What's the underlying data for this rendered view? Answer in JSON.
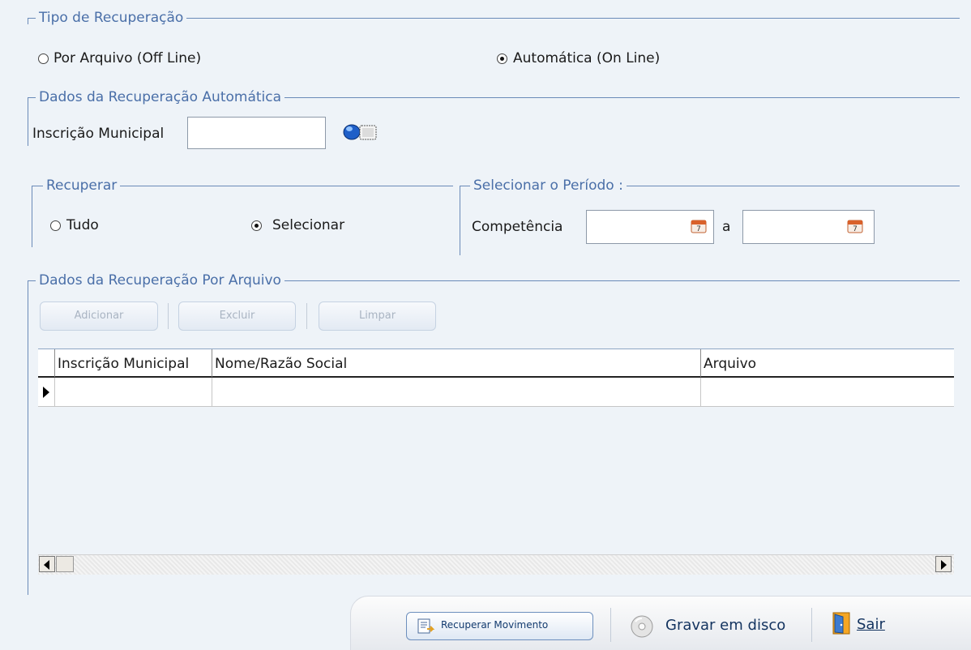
{
  "tipo_recuperacao": {
    "legend": "Tipo de Recuperação",
    "option_arquivo": "Por Arquivo (Off Line)",
    "option_automatica": "Automática (On Line)",
    "selected": "automatica"
  },
  "dados_automatica": {
    "legend": "Dados da Recuperação Automática",
    "inscricao_label": "Inscrição Municipal",
    "inscricao_value": ""
  },
  "recuperar": {
    "legend": "Recuperar",
    "option_tudo": "Tudo",
    "option_selecionar": "Selecionar",
    "selected": "selecionar"
  },
  "periodo": {
    "legend": "Selecionar o Período :",
    "competencia_label": "Competência",
    "separator": "a",
    "from_value": "",
    "to_value": ""
  },
  "dados_arquivo": {
    "legend": "Dados da Recuperação Por Arquivo",
    "buttons": {
      "adicionar": "Adicionar",
      "excluir": "Excluir",
      "limpar": "Limpar"
    },
    "columns": [
      "Inscrição Municipal",
      "Nome/Razão Social",
      "Arquivo"
    ],
    "rows": [
      [
        "",
        "",
        ""
      ]
    ]
  },
  "footer": {
    "recuperar_label": "Recuperar Movimento",
    "gravar_label": "Gravar em disco",
    "sair_label": "Sair"
  },
  "icons": {
    "lookup": "search-binoculars-icon",
    "calendar": "calendar-icon",
    "disc": "disc-icon",
    "exit": "door-exit-icon",
    "recuperar": "document-arrow-icon"
  }
}
